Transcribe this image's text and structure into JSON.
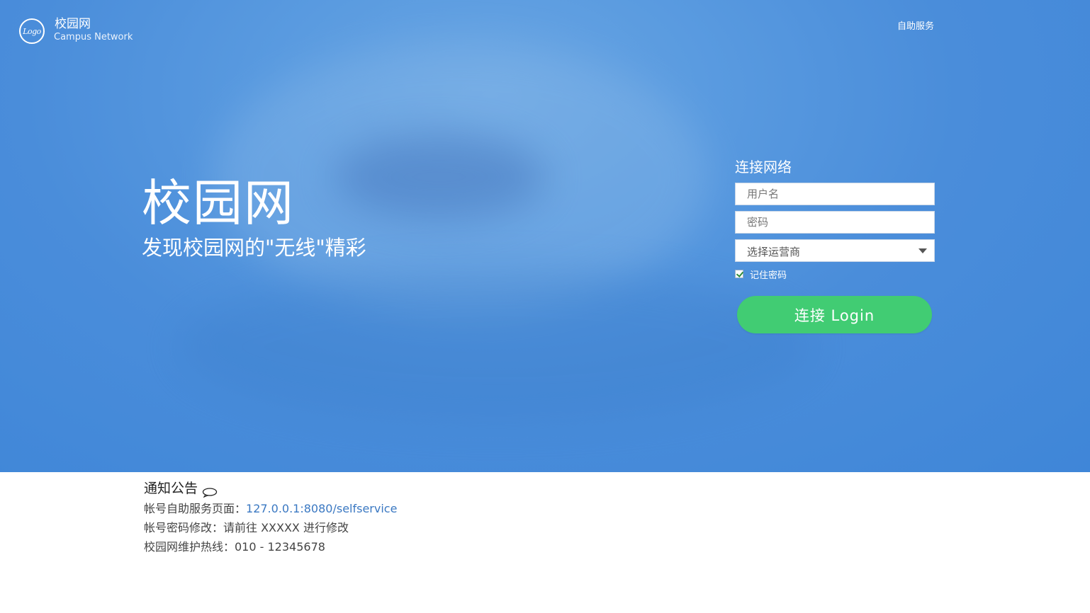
{
  "header": {
    "logo_text": "Logo",
    "brand_name": "校园网",
    "brand_sub": "Campus Network",
    "selfservice_label": "自助服务"
  },
  "hero": {
    "title": "校园网",
    "slogan": "发现校园网的\"无线\"精彩"
  },
  "login": {
    "title": "连接网络",
    "username_placeholder": "用户名",
    "password_placeholder": "密码",
    "carrier_select": "选择运营商",
    "remember_label": "记住密码",
    "remember_checked": true,
    "submit_label": "连接 Login"
  },
  "notice": {
    "title": "通知公告",
    "selfservice_prefix": "帐号自助服务页面：",
    "selfservice_url": "127.0.0.1:8080/selfservice",
    "password_change": "帐号密码修改：请前往 XXXXX 进行修改",
    "hotline": "校园网维护热线：010 - 12345678"
  },
  "colors": {
    "hero_bg": "#4a8dda",
    "login_button": "#41cc73",
    "link": "#3a78c2"
  }
}
